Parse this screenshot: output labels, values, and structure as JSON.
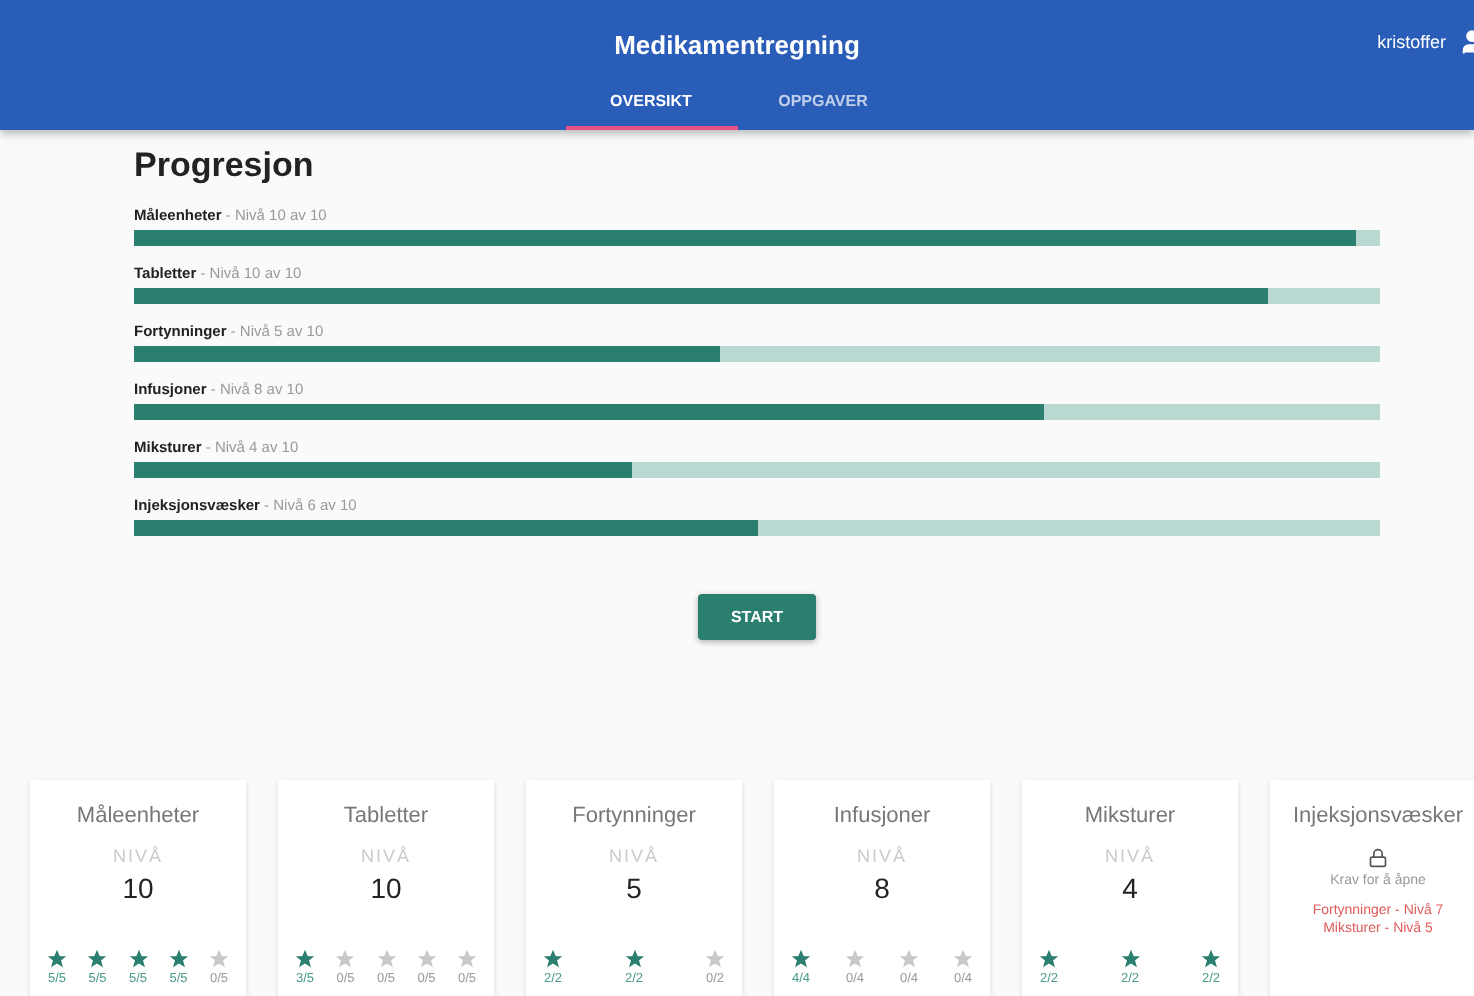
{
  "header": {
    "title": "Medikamentregning",
    "user": "kristoffer"
  },
  "tabs": [
    {
      "label": "OVERSIKT",
      "selected": true
    },
    {
      "label": "OPPGAVER",
      "selected": false
    }
  ],
  "progress": {
    "title": "Progresjon",
    "items": [
      {
        "name": "Måleenheter",
        "detail": "- Nivå 10 av 10",
        "level": 0.98
      },
      {
        "name": "Tabletter",
        "detail": "- Nivå 10 av 10",
        "level": 0.91
      },
      {
        "name": "Fortynninger",
        "detail": "- Nivå 5 av 10",
        "level": 0.47
      },
      {
        "name": "Infusjoner",
        "detail": "- Nivå 8 av 10",
        "level": 0.73
      },
      {
        "name": "Miksturer",
        "detail": "- Nivå 4 av 10",
        "level": 0.4
      },
      {
        "name": "Injeksjonsvæsker",
        "detail": "- Nivå 6 av 10",
        "level": 0.5
      }
    ]
  },
  "start_button": "START",
  "cards": [
    {
      "kind": "open",
      "title": "Måleenheter",
      "level_label": "NIVÅ",
      "level_value": "10",
      "stars": [
        {
          "filled": true,
          "label": "5/5"
        },
        {
          "filled": true,
          "label": "5/5"
        },
        {
          "filled": true,
          "label": "5/5"
        },
        {
          "filled": true,
          "label": "5/5"
        },
        {
          "filled": false,
          "label": "0/5"
        }
      ]
    },
    {
      "kind": "open",
      "title": "Tabletter",
      "level_label": "NIVÅ",
      "level_value": "10",
      "stars": [
        {
          "filled": true,
          "label": "3/5"
        },
        {
          "filled": false,
          "label": "0/5"
        },
        {
          "filled": false,
          "label": "0/5"
        },
        {
          "filled": false,
          "label": "0/5"
        },
        {
          "filled": false,
          "label": "0/5"
        }
      ]
    },
    {
      "kind": "open",
      "title": "Fortynninger",
      "level_label": "NIVÅ",
      "level_value": "5",
      "stars": [
        {
          "filled": true,
          "label": "2/2"
        },
        {
          "filled": true,
          "label": "2/2"
        },
        {
          "filled": false,
          "label": "0/2"
        }
      ]
    },
    {
      "kind": "open",
      "title": "Infusjoner",
      "level_label": "NIVÅ",
      "level_value": "8",
      "stars": [
        {
          "filled": true,
          "label": "4/4"
        },
        {
          "filled": false,
          "label": "0/4"
        },
        {
          "filled": false,
          "label": "0/4"
        },
        {
          "filled": false,
          "label": "0/4"
        }
      ]
    },
    {
      "kind": "open",
      "title": "Miksturer",
      "level_label": "NIVÅ",
      "level_value": "4",
      "stars": [
        {
          "filled": true,
          "label": "2/2"
        },
        {
          "filled": true,
          "label": "2/2"
        },
        {
          "filled": true,
          "label": "2/2"
        }
      ]
    },
    {
      "kind": "locked",
      "title": "Injeksjonsvæsker",
      "lock_text": "Krav for å åpne",
      "requirements": [
        "Fortynninger - Nivå 7",
        "Miksturer - Nivå 5"
      ]
    }
  ]
}
